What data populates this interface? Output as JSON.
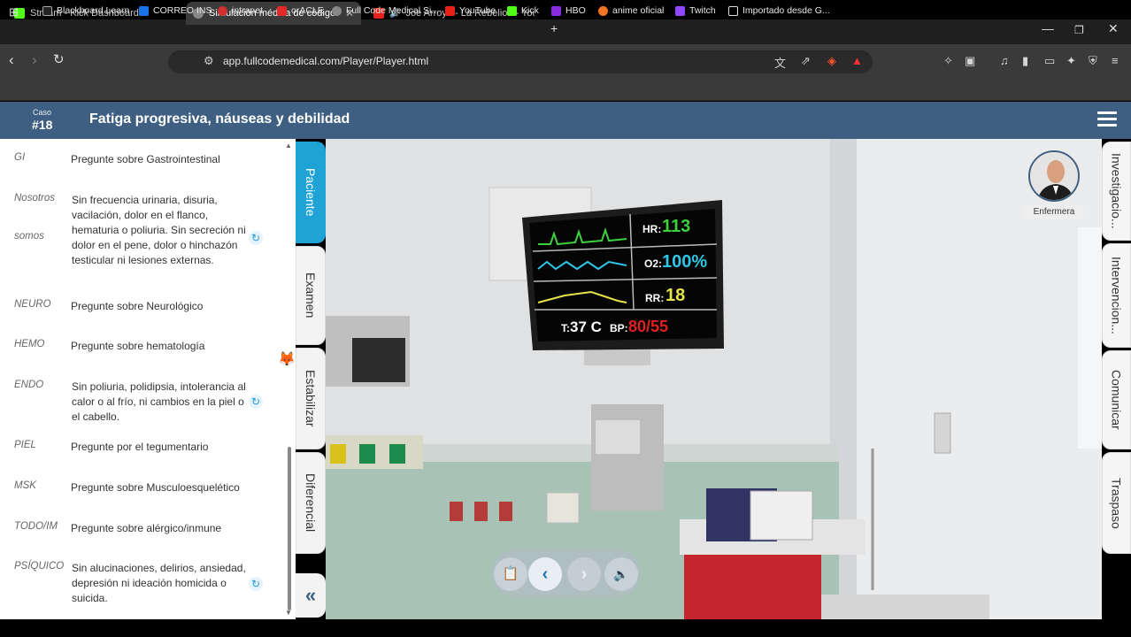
{
  "browser": {
    "tabs": [
      {
        "title": "Stream - Kick Dashboard",
        "active": false
      },
      {
        "title": "Simulación médica de código co",
        "active": true
      },
      {
        "title": "Joe Arroyo - La Rebelion - YouTu",
        "active": false
      }
    ],
    "url": "app.fullcodemedical.com/Player/Player.html",
    "bookmarks": [
      "Blackboard Learn",
      "CORREO INS",
      "intranet",
      "orACLE",
      "Full Code Medical Si...",
      "YouTube",
      "Kick",
      "HBO",
      "anime oficial",
      "Twitch",
      "Importado desde G..."
    ]
  },
  "header": {
    "case_label": "Caso",
    "case_number": "#18",
    "title": "Fatiga progresiva, náuseas y debilidad"
  },
  "ros": [
    {
      "code": "GI",
      "text": "Pregunte sobre Gastrointestinal",
      "refresh": false
    },
    {
      "code": "Nosotros",
      "code2": "somos",
      "text": "Sin frecuencia urinaria, disuria, vacilación, dolor en el flanco, hematuria o poliuria. Sin secreción ni dolor en el pene, dolor o hinchazón testicular ni lesiones externas.",
      "refresh": true
    },
    {
      "code": "NEURO",
      "text": "Pregunte sobre Neurológico",
      "refresh": false
    },
    {
      "code": "HEMO",
      "text": "Pregunte sobre hematología",
      "refresh": false
    },
    {
      "code": "ENDO",
      "text": "Sin poliuria, polidipsia, intolerancia al calor o al frío, ni cambios en la piel o el cabello.",
      "refresh": true
    },
    {
      "code": "PIEL",
      "text": "Pregunte por el tegumentario",
      "refresh": false
    },
    {
      "code": "MSK",
      "text": "Pregunte sobre Musculoesquelético",
      "refresh": false
    },
    {
      "code": "TODO/IM",
      "text": "Pregunte sobre alérgico/inmune",
      "refresh": false
    },
    {
      "code": "PSÍQUICO",
      "text": "Sin alucinaciones, delirios, ansiedad, depresión ni ideación homicida o suicida.",
      "refresh": true
    }
  ],
  "left_tabs": [
    "Paciente",
    "Examen",
    "Estabilizar",
    "Diferencial"
  ],
  "right_tabs": [
    "Investigacio...",
    "Intervencion...",
    "Comunicar",
    "Traspaso"
  ],
  "nurse_label": "Enfermera",
  "monitor": {
    "hr_label": "HR:",
    "hr": "113",
    "o2_label": "O2:",
    "o2": "100%",
    "rr_label": "RR:",
    "rr": "18",
    "t_label": "T:",
    "t": "37 C",
    "bp_label": "BP:",
    "bp": "80/55"
  },
  "colors": {
    "header": "#3f5f82",
    "accent": "#1fa3d6",
    "hr": "#3ed13e",
    "o2": "#2fc6e6",
    "rr": "#e6e24a",
    "bp": "#e02020"
  }
}
